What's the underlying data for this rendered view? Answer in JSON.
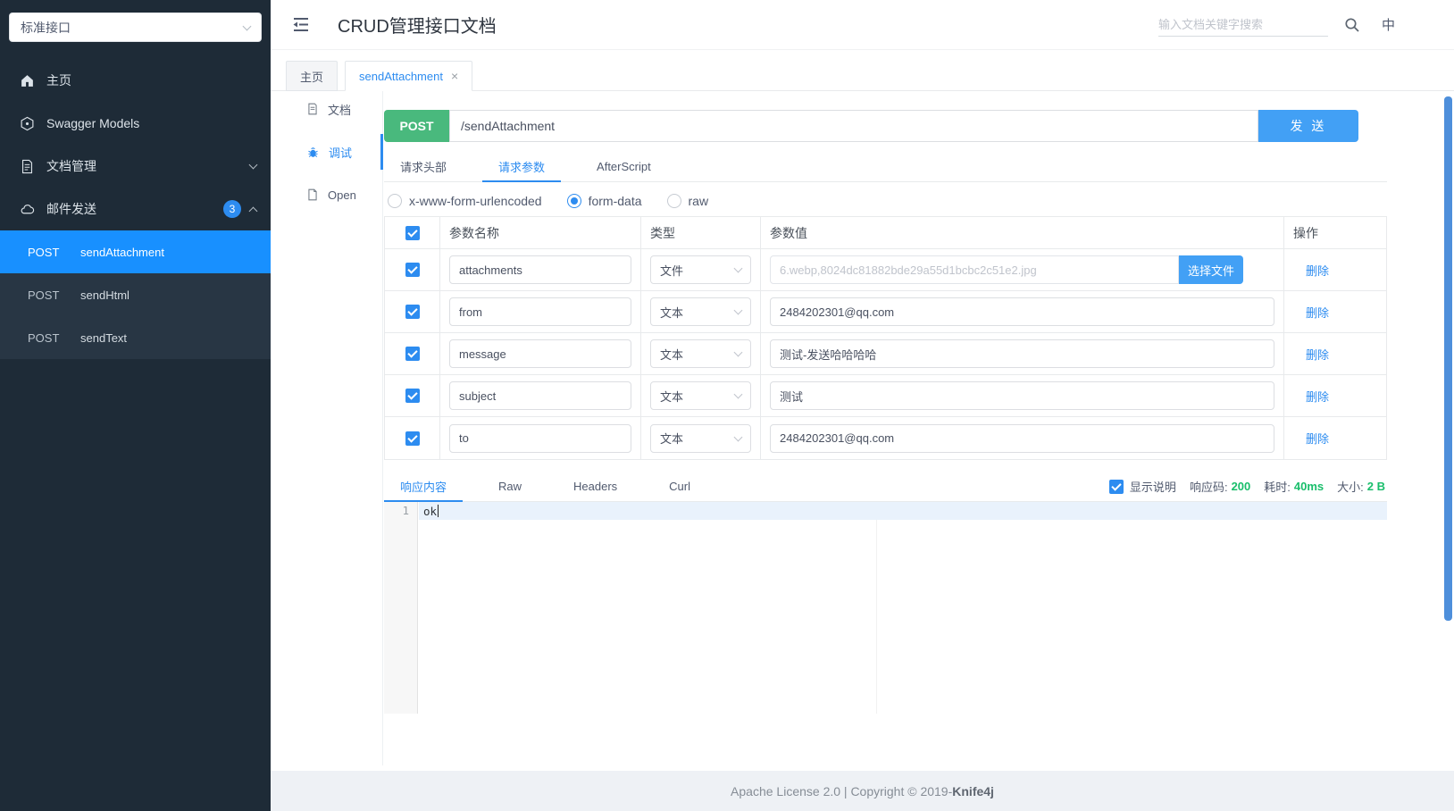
{
  "colors": {
    "accent": "#2d8cf0",
    "selected_menu": "#1890ff",
    "post_green": "#49b97d",
    "button_blue": "#42a0f5",
    "success_green": "#19be6b",
    "sidebar_bg": "#1e2b37"
  },
  "sidebar": {
    "group_select": "标准接口",
    "items": [
      {
        "label": "主页"
      },
      {
        "label": "Swagger Models"
      },
      {
        "label": "文档管理"
      },
      {
        "label": "邮件发送",
        "badge": "3"
      }
    ],
    "operations": [
      {
        "method": "POST",
        "name": "sendAttachment"
      },
      {
        "method": "POST",
        "name": "sendHtml"
      },
      {
        "method": "POST",
        "name": "sendText"
      }
    ]
  },
  "header": {
    "title": "CRUD管理接口文档",
    "search_placeholder": "输入文档关键字搜索",
    "lang": "中"
  },
  "tabbar": {
    "tabs": [
      {
        "label": "主页"
      },
      {
        "label": "sendAttachment"
      }
    ]
  },
  "doc_nav": {
    "items": [
      {
        "label": "文档"
      },
      {
        "label": "调试"
      },
      {
        "label": "Open"
      }
    ]
  },
  "debug": {
    "method": "POST",
    "url": "/sendAttachment",
    "send_label": "发 送",
    "tabs": [
      {
        "label": "请求头部"
      },
      {
        "label": "请求参数"
      },
      {
        "label": "AfterScript"
      }
    ],
    "body_modes": [
      {
        "label": "x-www-form-urlencoded"
      },
      {
        "label": "form-data"
      },
      {
        "label": "raw"
      }
    ],
    "table": {
      "col_name": "参数名称",
      "col_type": "类型",
      "col_value": "参数值",
      "col_action": "操作",
      "rows": [
        {
          "name": "attachments",
          "type": "文件",
          "value": "6.webp,8024dc81882bde29a55d1bcbc2c51e2.jpg",
          "file_button": "选择文件",
          "action": "删除"
        },
        {
          "name": "from",
          "type": "文本",
          "value": "2484202301@qq.com",
          "action": "删除"
        },
        {
          "name": "message",
          "type": "文本",
          "value": "测试-发送哈哈哈哈",
          "action": "删除"
        },
        {
          "name": "subject",
          "type": "文本",
          "value": "测试",
          "action": "删除"
        },
        {
          "name": "to",
          "type": "文本",
          "value": "2484202301@qq.com",
          "action": "删除"
        }
      ]
    }
  },
  "response": {
    "tabs": [
      {
        "label": "响应内容"
      },
      {
        "label": "Raw"
      },
      {
        "label": "Headers"
      },
      {
        "label": "Curl"
      }
    ],
    "show_desc": "显示说明",
    "stats": [
      {
        "label": "响应码:",
        "value": "200"
      },
      {
        "label": "耗时:",
        "value": "40ms"
      },
      {
        "label": "大小:",
        "value": "2 B"
      }
    ],
    "editor": {
      "line": "1",
      "content": "ok"
    }
  },
  "footer": {
    "text": "Apache License 2.0 | Copyright © 2019-",
    "brand": "Knife4j"
  }
}
